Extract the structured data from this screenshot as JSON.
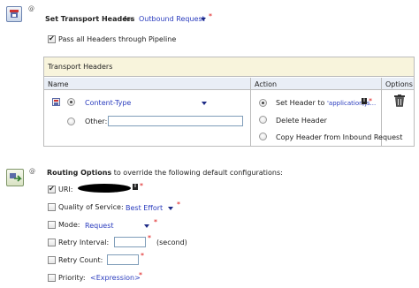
{
  "transport": {
    "set_label": "Set Transport Headers",
    "for_label": "for",
    "for_value": "Outbound Request",
    "required": "*",
    "pass_all_label": "Pass all Headers through Pipeline",
    "section_title": "Transport Headers",
    "columns": {
      "name": "Name",
      "action": "Action",
      "options": "Options"
    },
    "header_name": "Content-Type",
    "other_label": "Other:",
    "other_value": "",
    "actions": {
      "set_header": "Set Header to",
      "set_value": "'application/js...",
      "delete": "Delete Header",
      "copy": "Copy Header from Inbound Request"
    }
  },
  "routing": {
    "title": "Routing Options",
    "subtitle": "to override the following default configurations:",
    "uri_label": "URI:",
    "qos_label": "Quality of Service:",
    "qos_value": "Best Effort",
    "mode_label": "Mode:",
    "mode_value": "Request",
    "retry_interval_label": "Retry Interval:",
    "retry_interval_unit": "(second)",
    "retry_count_label": "Retry Count:",
    "priority_label": "Priority:",
    "priority_value": "<Expression>",
    "required": "*"
  },
  "colors": {
    "accent_blue": "#2a3cbe",
    "required_red": "#dd1111",
    "section_bg": "#f8f4dc",
    "header_bg": "#e9eef6"
  },
  "icons": [
    "transport-headers-icon",
    "routing-options-icon",
    "info-icon",
    "delete-icon",
    "header-expression-icon"
  ]
}
